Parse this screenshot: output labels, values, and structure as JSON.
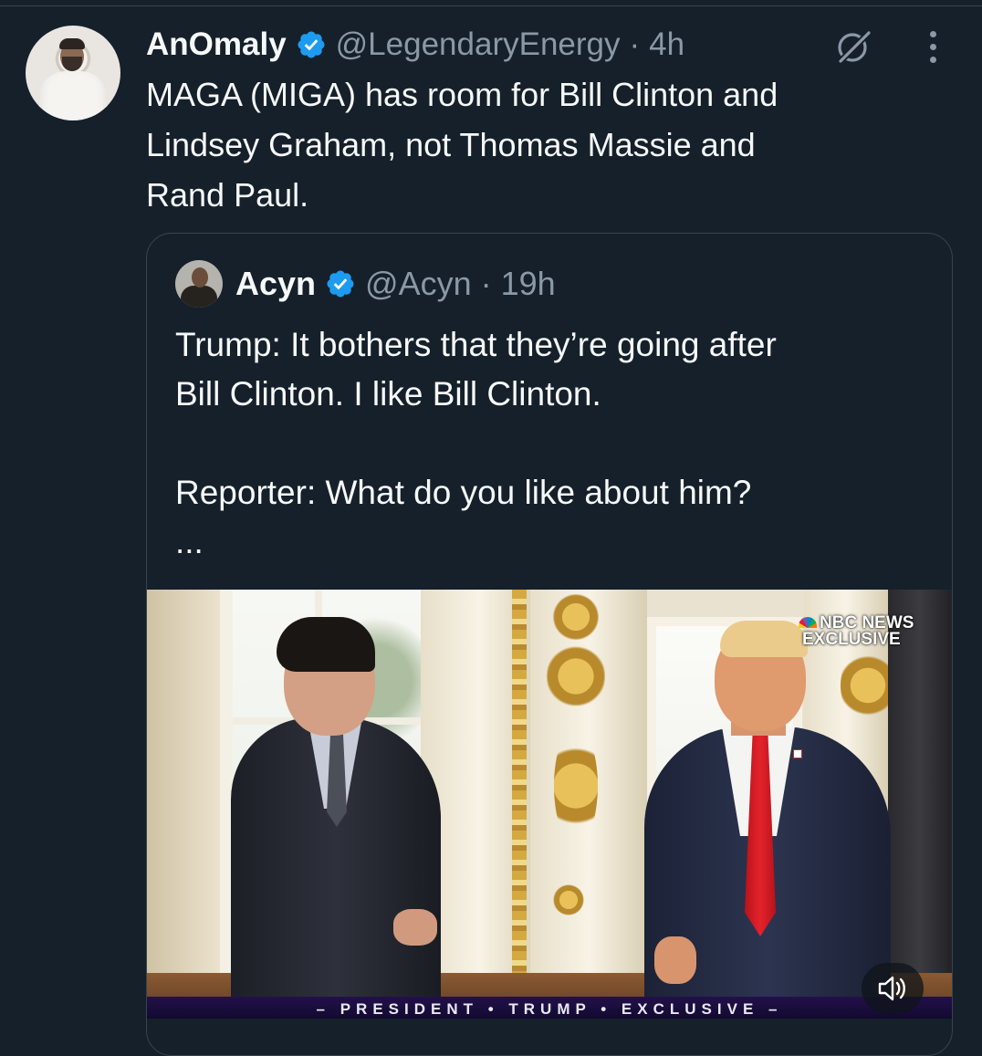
{
  "tweet": {
    "author": {
      "display_name": "AnOmaly",
      "handle": "@LegendaryEnergy",
      "separator": "·",
      "time": "4h"
    },
    "text_lines": [
      "MAGA (MIGA) has room for Bill Clinton and",
      "Lindsey Graham, not Thomas Massie and",
      "Rand Paul."
    ]
  },
  "quote": {
    "author": {
      "display_name": "Acyn",
      "handle": "@Acyn",
      "separator": "·",
      "time": "19h"
    },
    "text_lines": [
      "Trump: It bothers that they’re going after",
      "Bill Clinton. I like Bill Clinton.",
      "",
      "Reporter: What do you like about him?",
      "..."
    ],
    "media": {
      "overlay_logo_line1": "NBC NEWS",
      "overlay_logo_line2": "EXCLUSIVE",
      "chyron": "– PRESIDENT • TRUMP • EXCLUSIVE –"
    }
  },
  "icons": {
    "verified": "verified-badge-icon",
    "grok": "grok-icon",
    "more": "more-options-icon",
    "sound": "speaker-unmute-icon"
  },
  "colors": {
    "background": "#15202b",
    "text_primary": "#f7f9f9",
    "text_secondary": "#8b98a5",
    "verified_blue": "#1d9bf0",
    "border": "#38444d"
  }
}
